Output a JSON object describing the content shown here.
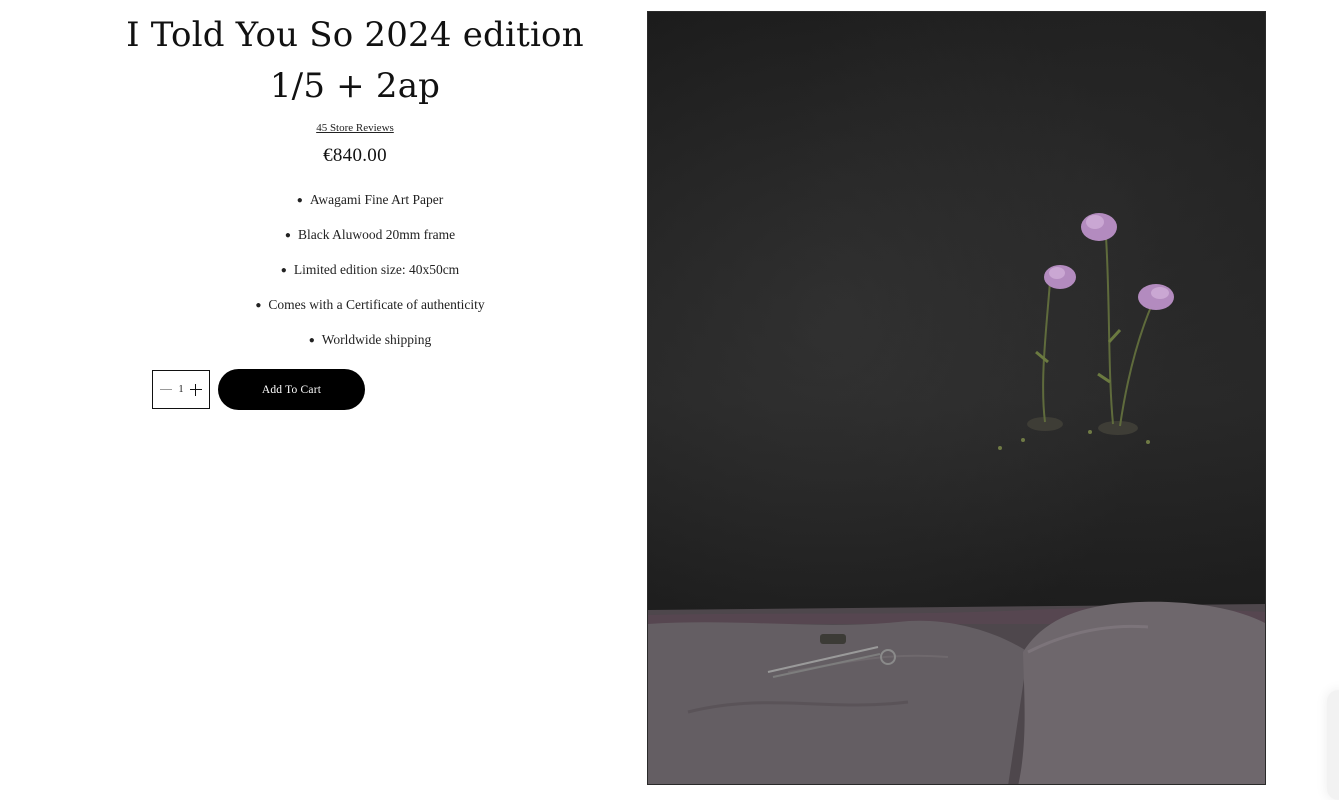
{
  "product": {
    "title_line1": "I Told You So 2024 edition",
    "title_line2": "1/5 + 2ap",
    "reviews_link": "45 Store Reviews",
    "price": "€840.00",
    "features": [
      "Awagami Fine Art Paper",
      "Black Aluwood 20mm frame",
      "Limited edition size: 40x50cm",
      "Comes with a Certificate of authenticity",
      "Worldwide shipping"
    ]
  },
  "cart": {
    "quantity": "1",
    "add_label": "Add To Cart",
    "minus_icon": "minus-icon",
    "plus_icon": "plus-icon"
  },
  "photo": {
    "subject": "product-photo",
    "colors": {
      "backdrop": "#1f1f1f",
      "sheet": "#6a6468",
      "flower": "#b38bbf",
      "stem": "#5f6b3c"
    }
  }
}
